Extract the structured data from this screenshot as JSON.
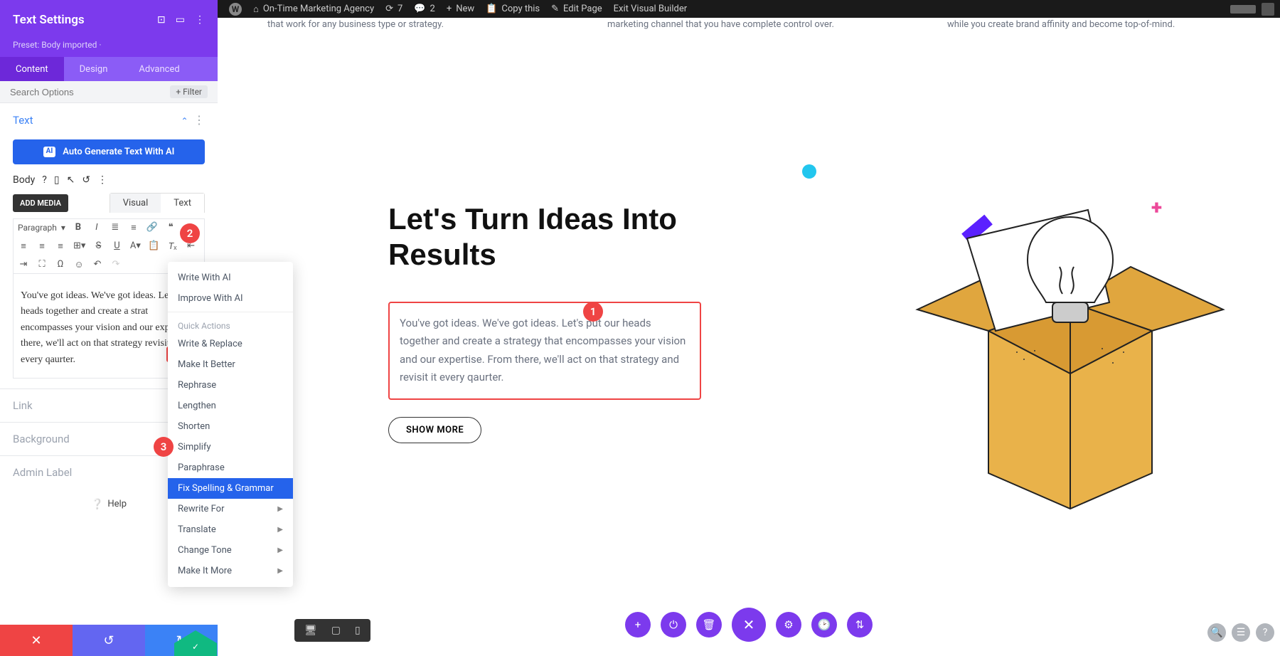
{
  "admin": {
    "site": "On-Time Marketing Agency",
    "updates": "7",
    "comments": "2",
    "new": "New",
    "copy": "Copy this",
    "edit": "Edit Page",
    "exit": "Exit Visual Builder"
  },
  "sidebar": {
    "title": "Text Settings",
    "preset": "Preset: Body imported ·",
    "tabs": {
      "content": "Content",
      "design": "Design",
      "advanced": "Advanced"
    },
    "search_placeholder": "Search Options",
    "filter": "Filter",
    "text_section": "Text",
    "ai_button": "Auto Generate Text With AI",
    "body_label": "Body",
    "add_media": "ADD MEDIA",
    "editor_modes": {
      "visual": "Visual",
      "text": "Text"
    },
    "paragraph": "Paragraph",
    "editor_text": "You've got ideas. We've got ideas. Let our heads together and create a strat encompasses your vision and our exp From there, we'll act on that strategy revisit it every qaurter.",
    "sections": {
      "link": "Link",
      "background": "Background",
      "admin_label": "Admin Label"
    },
    "help": "Help"
  },
  "ai_menu": {
    "write": "Write With AI",
    "improve": "Improve With AI",
    "quick": "Quick Actions",
    "items": [
      "Write & Replace",
      "Make It Better",
      "Rephrase",
      "Lengthen",
      "Shorten",
      "Simplify",
      "Paraphrase",
      "Fix Spelling & Grammar",
      "Rewrite For",
      "Translate",
      "Change Tone",
      "Make It More"
    ]
  },
  "canvas": {
    "snip1": "that work for any business type or strategy.",
    "snip2": "marketing channel that you have complete control over.",
    "snip3": "while you create brand affinity and become top-of-mind.",
    "heading": "Let's Turn Ideas Into Results",
    "paragraph": "You've got ideas. We've got ideas. Let's put our heads together and create a strategy that encompasses your vision and our expertise. From there, we'll act on that strategy and revisit it every qaurter.",
    "button": "SHOW MORE"
  },
  "annotations": {
    "a1": "1",
    "a2": "2",
    "a3": "3"
  }
}
